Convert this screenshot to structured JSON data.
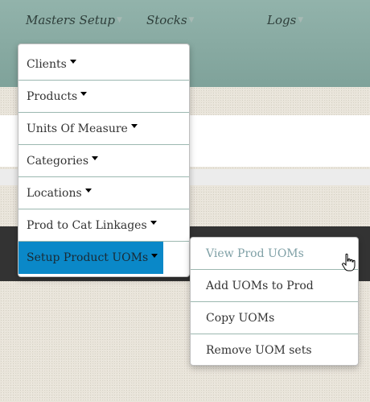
{
  "nav": {
    "masters_setup": "Masters Setup",
    "stocks": "Stocks",
    "logs": "Logs"
  },
  "masters_menu": {
    "items": [
      {
        "label": "Clients"
      },
      {
        "label": "Products"
      },
      {
        "label": "Units Of Measure"
      },
      {
        "label": "Categories"
      },
      {
        "label": "Locations"
      },
      {
        "label": "Prod to Cat Linkages"
      },
      {
        "label": "Setup Product UOMs",
        "active": true
      }
    ]
  },
  "uom_submenu": {
    "items": [
      {
        "label": "View Prod UOMs",
        "hovered": true
      },
      {
        "label": "Add UOMs to Prod"
      },
      {
        "label": "Copy UOMs"
      },
      {
        "label": "Remove UOM sets"
      }
    ]
  },
  "colors": {
    "topbar": "#86a79f",
    "active_item": "#0a88c8",
    "dark_bar": "#333333",
    "muted_text": "#7fa0a6"
  },
  "icons": [
    "caret-down-icon",
    "hand-pointer-cursor-icon"
  ]
}
